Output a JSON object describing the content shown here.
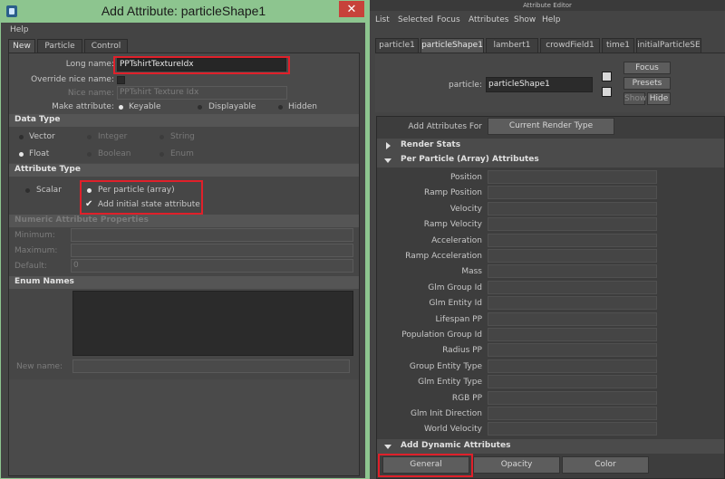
{
  "left_window": {
    "title": "Add Attribute: particleShape1",
    "close_glyph": "✕",
    "menu": {
      "help": "Help"
    },
    "tabs": [
      "New",
      "Particle",
      "Control"
    ],
    "long_name_label": "Long name:",
    "long_name_value": "PPTshirtTextureIdx",
    "override_nice_name_label": "Override nice name:",
    "nice_name_label": "Nice name:",
    "nice_name_value": "PPTshirt Texture Idx",
    "make_attribute_label": "Make attribute:",
    "make_attribute_options": [
      "Keyable",
      "Displayable",
      "Hidden"
    ],
    "data_type": {
      "heading": "Data Type",
      "options": [
        "Vector",
        "Integer",
        "String",
        "Float",
        "Boolean",
        "Enum"
      ]
    },
    "attribute_type": {
      "heading": "Attribute Type",
      "scalar": "Scalar",
      "per_particle": "Per particle (array)",
      "add_initial_state": "Add initial state attribute",
      "add_initial_state_checked": true
    },
    "numeric_properties": {
      "heading": "Numeric Attribute Properties",
      "minimum_label": "Minimum:",
      "maximum_label": "Maximum:",
      "default_label": "Default:",
      "default_value": "0"
    },
    "enum_names": {
      "heading": "Enum Names",
      "new_name_label": "New name:"
    }
  },
  "right_window": {
    "title": "Attribute Editor",
    "menu": [
      "List",
      "Selected",
      "Focus",
      "Attributes",
      "Show",
      "Help"
    ],
    "tabs": [
      "particle1",
      "particleShape1",
      "lambert1",
      "crowdField1",
      "time1",
      "initialParticleSE"
    ],
    "particle_label": "particle:",
    "particle_value": "particleShape1",
    "focus_button": "Focus",
    "presets_button": "Presets",
    "show_button": "Show",
    "hide_button": "Hide",
    "add_attributes_for_label": "Add Attributes For",
    "current_render_type_button": "Current Render Type",
    "render_stats": "Render Stats",
    "per_particle_heading": "Per Particle (Array) Attributes",
    "attributes": [
      "Position",
      "Ramp Position",
      "Velocity",
      "Ramp Velocity",
      "Acceleration",
      "Ramp Acceleration",
      "Mass",
      "Glm Group Id",
      "Glm Entity Id",
      "Lifespan PP",
      "Population Group Id",
      "Radius PP",
      "Group Entity Type",
      "Glm Entity Type",
      "RGB PP",
      "Glm Init Direction",
      "World Velocity"
    ],
    "add_dynamic_heading": "Add Dynamic Attributes",
    "dynamic_buttons": [
      "General",
      "Opacity",
      "Color"
    ]
  },
  "colors": {
    "window_border": "#8dc58f",
    "highlight": "#e0202a",
    "close_button": "#c7423a"
  }
}
